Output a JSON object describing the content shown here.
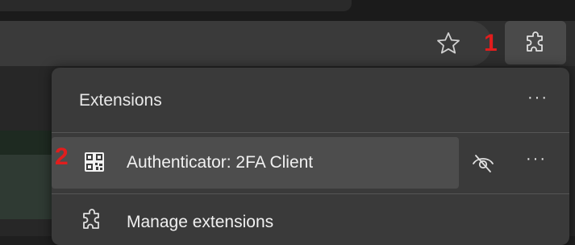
{
  "toolbar": {
    "favorite_icon": "star-outline-icon",
    "extensions_icon": "puzzle-piece-icon",
    "annotation_1": "1"
  },
  "extensions_menu": {
    "title": "Extensions",
    "more_label": "···",
    "items": [
      {
        "name": "Authenticator: 2FA Client",
        "icon": "qr-code-icon",
        "visibility_icon": "eye-off-icon",
        "more_label": "···",
        "annotation": "2"
      }
    ],
    "manage_label": "Manage extensions",
    "manage_icon": "puzzle-piece-icon"
  },
  "colors": {
    "annotation_red": "#e11d1d",
    "menu_bg": "#3a3a3a",
    "highlight_row": "#4d4d4d"
  }
}
